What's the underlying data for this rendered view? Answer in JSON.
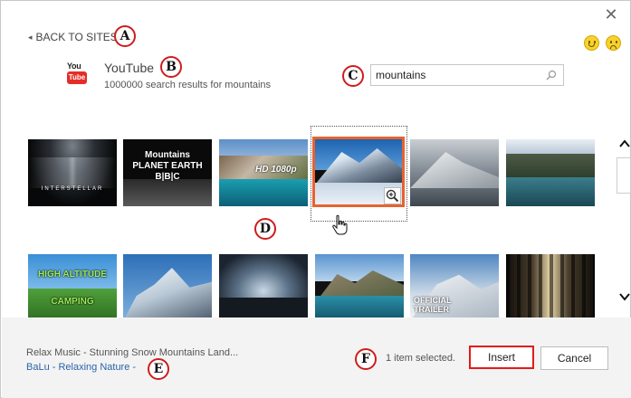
{
  "header": {
    "back_label": "BACK TO SITES",
    "close_glyph": "✕"
  },
  "source": {
    "logo_top": "You",
    "logo_bottom": "Tube",
    "name": "YouTube",
    "results_text": "1000000 search results for mountains"
  },
  "search": {
    "value": "mountains"
  },
  "grid": {
    "row1": [
      {
        "caption": "INTERSTELLAR"
      },
      {
        "caption": "Mountains PLANET EARTH B|B|C"
      },
      {
        "caption": "HD 1080p"
      },
      {
        "caption": ""
      },
      {
        "caption": ""
      },
      {
        "caption": ""
      }
    ],
    "row2": [
      {
        "caption": "HIGH ALTITUDE CAMPING"
      },
      {
        "caption": ""
      },
      {
        "caption": ""
      },
      {
        "caption": ""
      },
      {
        "caption": "OFFICIAL TRAILER"
      },
      {
        "caption": ""
      }
    ]
  },
  "callouts": {
    "a": "A",
    "b": "B",
    "c": "C",
    "d": "D",
    "e": "E",
    "f": "F"
  },
  "footer": {
    "video_title": "Relax Music - Stunning Snow Mountains Land...",
    "author": "BaLu - Relaxing Nature -",
    "selected_count": "1 item selected.",
    "insert_label": "Insert",
    "cancel_label": "Cancel"
  },
  "colors": {
    "accent_orange": "#e8622e",
    "callout_red": "#d01c1c",
    "link_blue": "#2a64a9",
    "youtube_red": "#e52d27"
  }
}
